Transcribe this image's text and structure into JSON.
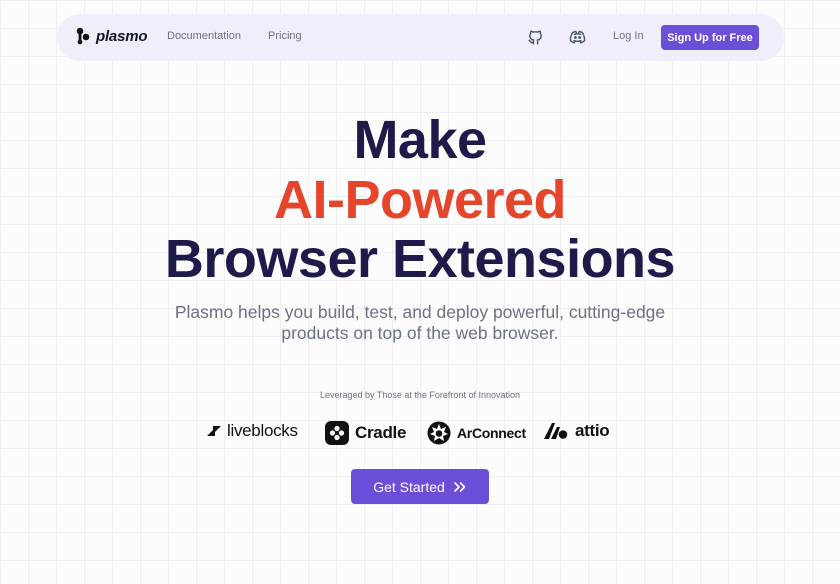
{
  "nav": {
    "brand": "plasmo",
    "links": {
      "documentation": "Documentation",
      "pricing": "Pricing"
    },
    "login": "Log In",
    "signup": "Sign Up for Free",
    "icons": [
      "plasmo-logo-icon",
      "github-icon",
      "discord-icon"
    ]
  },
  "hero": {
    "line1": "Make",
    "line2": "AI-Powered",
    "line3": "Browser Extensions",
    "subtitle": "Plasmo helps you build, test, and deploy powerful, cutting-edge products on top of the web browser.",
    "colors": {
      "primary": "#1e1b4b",
      "accent": "#e5452a"
    }
  },
  "trusted": {
    "heading": "Leveraged by Those at the Forefront of Innovation",
    "logos": [
      "liveblocks",
      "Cradle",
      "ArConnect",
      "attio"
    ]
  },
  "cta": {
    "label": "Get Started",
    "icon": "double-chevron-right-icon"
  },
  "theme": {
    "button": "#6b4fd8",
    "navbar_bg": "#f1eefb"
  }
}
